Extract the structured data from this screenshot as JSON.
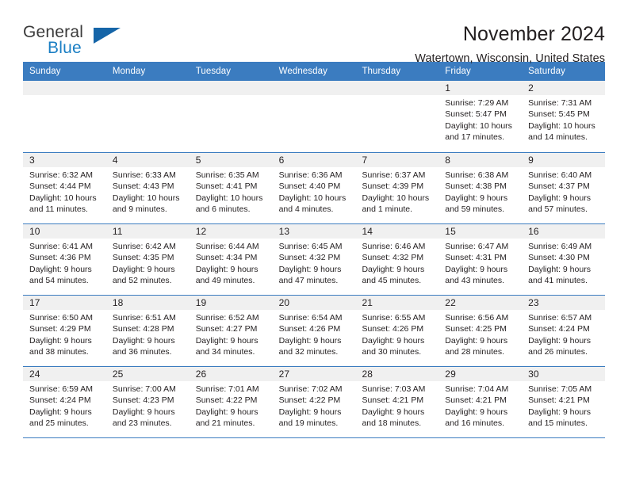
{
  "brand": {
    "name_top": "General",
    "name_bottom": "Blue",
    "triangle_color": "#1565a8",
    "blue_text_color": "#1b7fc4"
  },
  "header": {
    "title": "November 2024",
    "location": "Watertown, Wisconsin, United States"
  },
  "theme": {
    "header_blue": "#3b7cc0",
    "date_band": "#f0f0f0",
    "text": "#231f20"
  },
  "weekdays": [
    "Sunday",
    "Monday",
    "Tuesday",
    "Wednesday",
    "Thursday",
    "Friday",
    "Saturday"
  ],
  "labels": {
    "sunrise_prefix": "Sunrise: ",
    "sunset_prefix": "Sunset: ",
    "daylight_prefix": "Daylight: "
  },
  "weeks": [
    [
      {
        "day": "",
        "lines": []
      },
      {
        "day": "",
        "lines": []
      },
      {
        "day": "",
        "lines": []
      },
      {
        "day": "",
        "lines": []
      },
      {
        "day": "",
        "lines": []
      },
      {
        "day": "1",
        "lines": [
          "Sunrise: 7:29 AM",
          "Sunset: 5:47 PM",
          "Daylight: 10 hours",
          "and 17 minutes."
        ]
      },
      {
        "day": "2",
        "lines": [
          "Sunrise: 7:31 AM",
          "Sunset: 5:45 PM",
          "Daylight: 10 hours",
          "and 14 minutes."
        ]
      }
    ],
    [
      {
        "day": "3",
        "lines": [
          "Sunrise: 6:32 AM",
          "Sunset: 4:44 PM",
          "Daylight: 10 hours",
          "and 11 minutes."
        ]
      },
      {
        "day": "4",
        "lines": [
          "Sunrise: 6:33 AM",
          "Sunset: 4:43 PM",
          "Daylight: 10 hours",
          "and 9 minutes."
        ]
      },
      {
        "day": "5",
        "lines": [
          "Sunrise: 6:35 AM",
          "Sunset: 4:41 PM",
          "Daylight: 10 hours",
          "and 6 minutes."
        ]
      },
      {
        "day": "6",
        "lines": [
          "Sunrise: 6:36 AM",
          "Sunset: 4:40 PM",
          "Daylight: 10 hours",
          "and 4 minutes."
        ]
      },
      {
        "day": "7",
        "lines": [
          "Sunrise: 6:37 AM",
          "Sunset: 4:39 PM",
          "Daylight: 10 hours",
          "and 1 minute."
        ]
      },
      {
        "day": "8",
        "lines": [
          "Sunrise: 6:38 AM",
          "Sunset: 4:38 PM",
          "Daylight: 9 hours",
          "and 59 minutes."
        ]
      },
      {
        "day": "9",
        "lines": [
          "Sunrise: 6:40 AM",
          "Sunset: 4:37 PM",
          "Daylight: 9 hours",
          "and 57 minutes."
        ]
      }
    ],
    [
      {
        "day": "10",
        "lines": [
          "Sunrise: 6:41 AM",
          "Sunset: 4:36 PM",
          "Daylight: 9 hours",
          "and 54 minutes."
        ]
      },
      {
        "day": "11",
        "lines": [
          "Sunrise: 6:42 AM",
          "Sunset: 4:35 PM",
          "Daylight: 9 hours",
          "and 52 minutes."
        ]
      },
      {
        "day": "12",
        "lines": [
          "Sunrise: 6:44 AM",
          "Sunset: 4:34 PM",
          "Daylight: 9 hours",
          "and 49 minutes."
        ]
      },
      {
        "day": "13",
        "lines": [
          "Sunrise: 6:45 AM",
          "Sunset: 4:32 PM",
          "Daylight: 9 hours",
          "and 47 minutes."
        ]
      },
      {
        "day": "14",
        "lines": [
          "Sunrise: 6:46 AM",
          "Sunset: 4:32 PM",
          "Daylight: 9 hours",
          "and 45 minutes."
        ]
      },
      {
        "day": "15",
        "lines": [
          "Sunrise: 6:47 AM",
          "Sunset: 4:31 PM",
          "Daylight: 9 hours",
          "and 43 minutes."
        ]
      },
      {
        "day": "16",
        "lines": [
          "Sunrise: 6:49 AM",
          "Sunset: 4:30 PM",
          "Daylight: 9 hours",
          "and 41 minutes."
        ]
      }
    ],
    [
      {
        "day": "17",
        "lines": [
          "Sunrise: 6:50 AM",
          "Sunset: 4:29 PM",
          "Daylight: 9 hours",
          "and 38 minutes."
        ]
      },
      {
        "day": "18",
        "lines": [
          "Sunrise: 6:51 AM",
          "Sunset: 4:28 PM",
          "Daylight: 9 hours",
          "and 36 minutes."
        ]
      },
      {
        "day": "19",
        "lines": [
          "Sunrise: 6:52 AM",
          "Sunset: 4:27 PM",
          "Daylight: 9 hours",
          "and 34 minutes."
        ]
      },
      {
        "day": "20",
        "lines": [
          "Sunrise: 6:54 AM",
          "Sunset: 4:26 PM",
          "Daylight: 9 hours",
          "and 32 minutes."
        ]
      },
      {
        "day": "21",
        "lines": [
          "Sunrise: 6:55 AM",
          "Sunset: 4:26 PM",
          "Daylight: 9 hours",
          "and 30 minutes."
        ]
      },
      {
        "day": "22",
        "lines": [
          "Sunrise: 6:56 AM",
          "Sunset: 4:25 PM",
          "Daylight: 9 hours",
          "and 28 minutes."
        ]
      },
      {
        "day": "23",
        "lines": [
          "Sunrise: 6:57 AM",
          "Sunset: 4:24 PM",
          "Daylight: 9 hours",
          "and 26 minutes."
        ]
      }
    ],
    [
      {
        "day": "24",
        "lines": [
          "Sunrise: 6:59 AM",
          "Sunset: 4:24 PM",
          "Daylight: 9 hours",
          "and 25 minutes."
        ]
      },
      {
        "day": "25",
        "lines": [
          "Sunrise: 7:00 AM",
          "Sunset: 4:23 PM",
          "Daylight: 9 hours",
          "and 23 minutes."
        ]
      },
      {
        "day": "26",
        "lines": [
          "Sunrise: 7:01 AM",
          "Sunset: 4:22 PM",
          "Daylight: 9 hours",
          "and 21 minutes."
        ]
      },
      {
        "day": "27",
        "lines": [
          "Sunrise: 7:02 AM",
          "Sunset: 4:22 PM",
          "Daylight: 9 hours",
          "and 19 minutes."
        ]
      },
      {
        "day": "28",
        "lines": [
          "Sunrise: 7:03 AM",
          "Sunset: 4:21 PM",
          "Daylight: 9 hours",
          "and 18 minutes."
        ]
      },
      {
        "day": "29",
        "lines": [
          "Sunrise: 7:04 AM",
          "Sunset: 4:21 PM",
          "Daylight: 9 hours",
          "and 16 minutes."
        ]
      },
      {
        "day": "30",
        "lines": [
          "Sunrise: 7:05 AM",
          "Sunset: 4:21 PM",
          "Daylight: 9 hours",
          "and 15 minutes."
        ]
      }
    ]
  ]
}
